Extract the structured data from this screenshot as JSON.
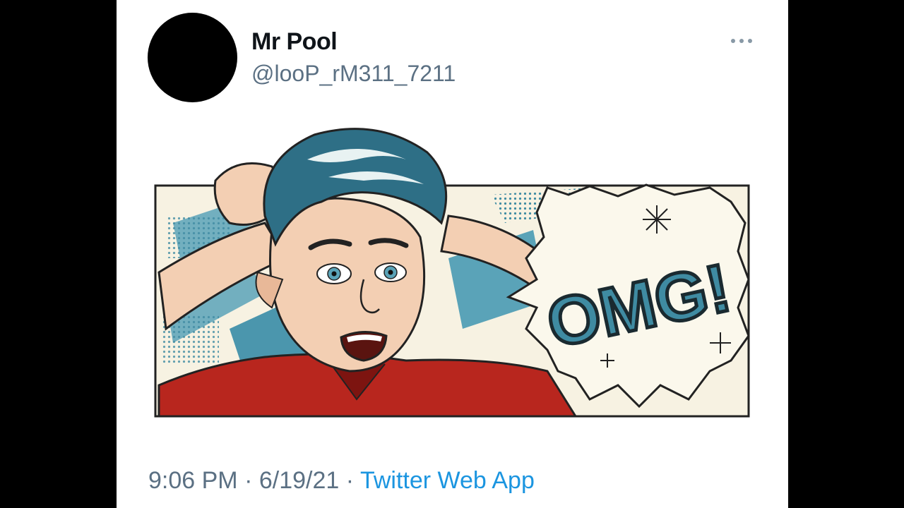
{
  "tweet": {
    "author": {
      "display_name": "Mr Pool",
      "handle": "@looP_rM311_7211"
    },
    "more_icon": "more-horizontal-icon",
    "media": {
      "kind": "comic-illustration",
      "caption_text": "OMG!"
    },
    "time": "9:06 PM",
    "separator": "·",
    "date": "6/19/21",
    "source": "Twitter Web App"
  },
  "colors": {
    "background": "#000000",
    "card": "#ffffff",
    "name": "#0f1419",
    "secondary_text": "#5b7083",
    "link": "#1b95e0",
    "comic_cream": "#f7f2e2",
    "comic_teal": "#3f8ba2",
    "comic_red": "#b8261e"
  }
}
